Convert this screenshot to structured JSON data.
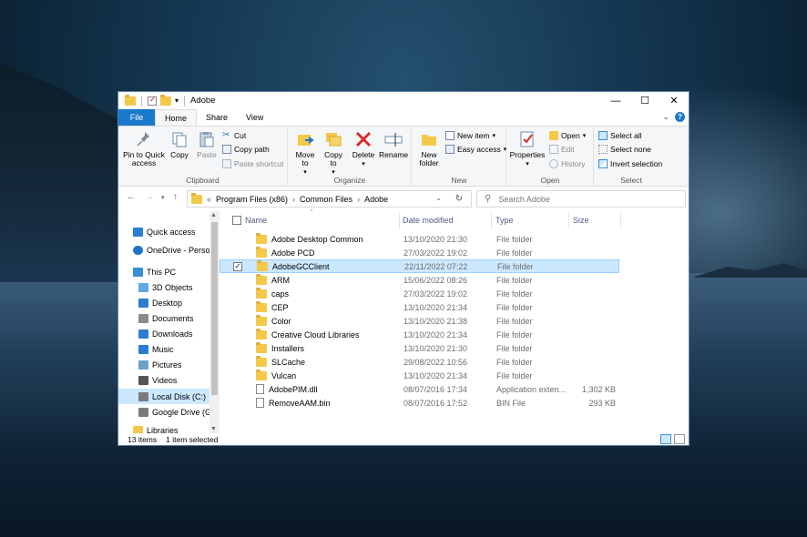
{
  "window": {
    "title": "Adobe",
    "controls": {
      "minimize": "—",
      "maximize": "☐",
      "close": "✕"
    }
  },
  "tabs": [
    "File",
    "Home",
    "Share",
    "View"
  ],
  "ribbon": {
    "clipboard": {
      "name": "Clipboard",
      "pin": "Pin to Quick access",
      "copy": "Copy",
      "paste": "Paste",
      "cut": "Cut",
      "copy_path": "Copy path",
      "paste_shortcut": "Paste shortcut"
    },
    "organize": {
      "name": "Organize",
      "move_to": "Move to",
      "copy_to": "Copy to",
      "delete": "Delete",
      "rename": "Rename"
    },
    "new": {
      "name": "New",
      "new_folder": "New folder",
      "new_item": "New item",
      "easy_access": "Easy access"
    },
    "open": {
      "name": "Open",
      "properties": "Properties",
      "open": "Open",
      "edit": "Edit",
      "history": "History"
    },
    "select": {
      "name": "Select",
      "select_all": "Select all",
      "select_none": "Select none",
      "invert_selection": "Invert selection"
    }
  },
  "address": {
    "overflow": "«",
    "crumbs": [
      "Program Files (x86)",
      "Common Files",
      "Adobe"
    ],
    "search_placeholder": "Search Adobe"
  },
  "nav": [
    {
      "label": "Quick access",
      "icon": "star-icon",
      "color": "#2b7cd3"
    },
    {
      "label": "OneDrive - Person",
      "icon": "cloud-icon",
      "color": "#1e73c8"
    },
    {
      "label": "This PC",
      "icon": "pc-icon",
      "color": "#3a8ed8"
    },
    {
      "label": "3D Objects",
      "icon": "cube-icon",
      "color": "#5fa8e6"
    },
    {
      "label": "Desktop",
      "icon": "desktop-icon",
      "color": "#2b7cd3"
    },
    {
      "label": "Documents",
      "icon": "document-icon",
      "color": "#8a8a8a"
    },
    {
      "label": "Downloads",
      "icon": "download-icon",
      "color": "#2b7cd3"
    },
    {
      "label": "Music",
      "icon": "music-icon",
      "color": "#2b7cd3"
    },
    {
      "label": "Pictures",
      "icon": "picture-icon",
      "color": "#6aa0cc"
    },
    {
      "label": "Videos",
      "icon": "video-icon",
      "color": "#555555"
    },
    {
      "label": "Local Disk (C:)",
      "icon": "disk-icon",
      "color": "#7a7a7a"
    },
    {
      "label": "Google Drive (G:",
      "icon": "drive-icon",
      "color": "#7a7a7a"
    },
    {
      "label": "Libraries",
      "icon": "library-icon",
      "color": "#f4c94a"
    }
  ],
  "columns": {
    "name": "Name",
    "date": "Date modified",
    "type": "Type",
    "size": "Size"
  },
  "files": [
    {
      "name": "Adobe Desktop Common",
      "date": "13/10/2020 21:30",
      "type": "File folder",
      "size": "",
      "kind": "folder"
    },
    {
      "name": "Adobe PCD",
      "date": "27/03/2022 19:02",
      "type": "File folder",
      "size": "",
      "kind": "folder"
    },
    {
      "name": "AdobeGCClient",
      "date": "22/11/2022 07:22",
      "type": "File folder",
      "size": "",
      "kind": "folder"
    },
    {
      "name": "ARM",
      "date": "15/06/2022 08:26",
      "type": "File folder",
      "size": "",
      "kind": "folder"
    },
    {
      "name": "caps",
      "date": "27/03/2022 19:02",
      "type": "File folder",
      "size": "",
      "kind": "folder"
    },
    {
      "name": "CEP",
      "date": "13/10/2020 21:34",
      "type": "File folder",
      "size": "",
      "kind": "folder"
    },
    {
      "name": "Color",
      "date": "13/10/2020 21:38",
      "type": "File folder",
      "size": "",
      "kind": "folder"
    },
    {
      "name": "Creative Cloud Libraries",
      "date": "13/10/2020 21:34",
      "type": "File folder",
      "size": "",
      "kind": "folder"
    },
    {
      "name": "Installers",
      "date": "13/10/2020 21:30",
      "type": "File folder",
      "size": "",
      "kind": "folder"
    },
    {
      "name": "SLCache",
      "date": "29/08/2022 10:56",
      "type": "File folder",
      "size": "",
      "kind": "folder"
    },
    {
      "name": "Vulcan",
      "date": "13/10/2020 21:34",
      "type": "File folder",
      "size": "",
      "kind": "folder"
    },
    {
      "name": "AdobePIM.dll",
      "date": "08/07/2016 17:34",
      "type": "Application exten...",
      "size": "1,302 KB",
      "kind": "file"
    },
    {
      "name": "RemoveAAM.bin",
      "date": "08/07/2016 17:52",
      "type": "BIN File",
      "size": "293 KB",
      "kind": "file"
    }
  ],
  "selected_index": 2,
  "status": {
    "count": "13 items",
    "selection": "1 item selected"
  }
}
